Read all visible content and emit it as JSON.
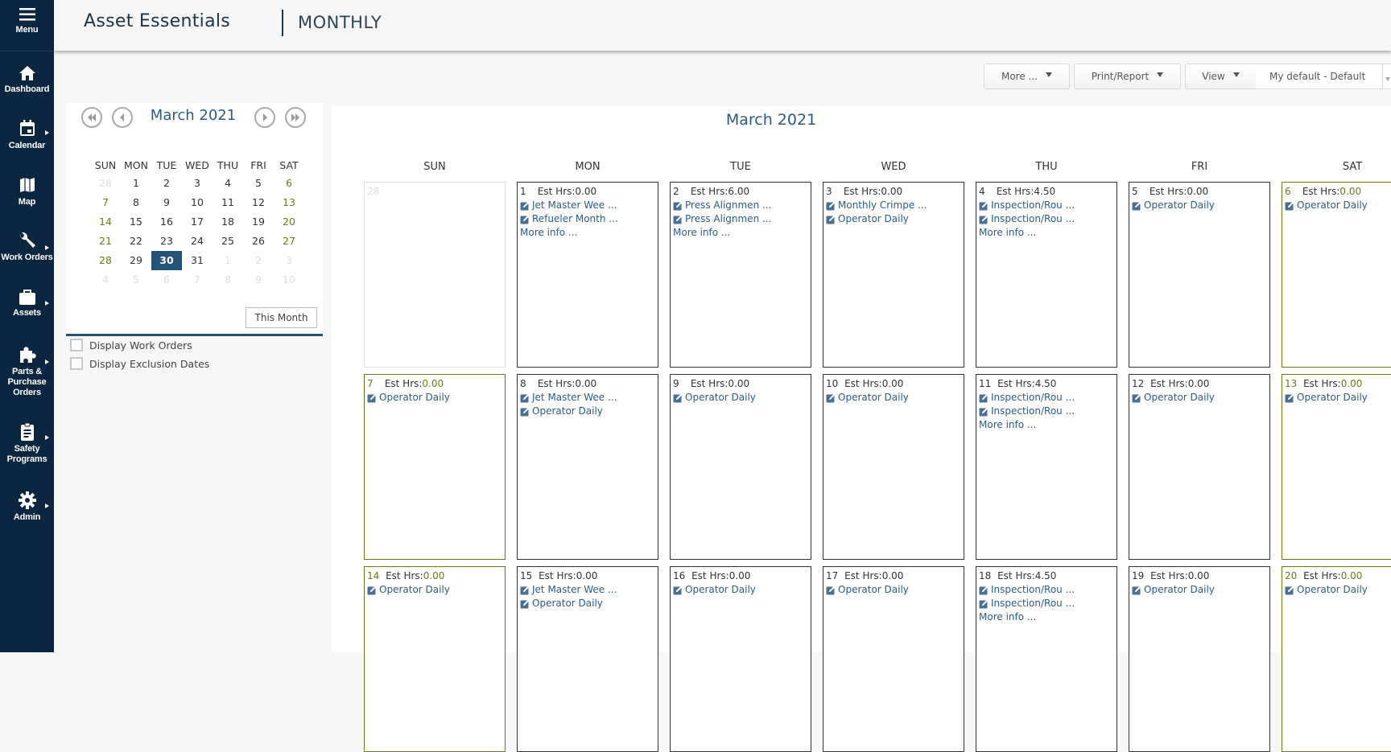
{
  "sidebar": {
    "items": [
      {
        "id": "menu",
        "label": "Menu",
        "icon": "hamburger-icon",
        "has_submenu": false
      },
      {
        "id": "dashboard",
        "label": "Dashboard",
        "icon": "home-icon",
        "has_submenu": false
      },
      {
        "id": "calendar",
        "label": "Calendar",
        "icon": "calendar-icon",
        "has_submenu": true
      },
      {
        "id": "map",
        "label": "Map",
        "icon": "map-icon",
        "has_submenu": false
      },
      {
        "id": "work-orders",
        "label": "Work Orders",
        "icon": "wrench-icon",
        "has_submenu": true
      },
      {
        "id": "assets",
        "label": "Assets",
        "icon": "briefcase-icon",
        "has_submenu": true
      },
      {
        "id": "parts",
        "label": "Parts & Purchase Orders",
        "icon": "puzzle-icon",
        "has_submenu": true
      },
      {
        "id": "safety",
        "label": "Safety Programs",
        "icon": "clipboard-icon",
        "has_submenu": true
      },
      {
        "id": "admin",
        "label": "Admin",
        "icon": "gear-icon",
        "has_submenu": true
      }
    ]
  },
  "header": {
    "app_title": "Asset Essentials",
    "page_title": "MONTHLY"
  },
  "toolbar": {
    "more_label": "More ...",
    "print_label": "Print/Report",
    "view_label": "View",
    "view_default_value": "My default - Default"
  },
  "mini_calendar": {
    "title": "March 2021",
    "weekdays": [
      "SUN",
      "MON",
      "TUE",
      "WED",
      "THU",
      "FRI",
      "SAT"
    ],
    "weeks": [
      [
        {
          "d": "28",
          "t": "other"
        },
        {
          "d": "1"
        },
        {
          "d": "2"
        },
        {
          "d": "3"
        },
        {
          "d": "4"
        },
        {
          "d": "5"
        },
        {
          "d": "6",
          "t": "wk"
        }
      ],
      [
        {
          "d": "7",
          "t": "wk"
        },
        {
          "d": "8"
        },
        {
          "d": "9"
        },
        {
          "d": "10"
        },
        {
          "d": "11"
        },
        {
          "d": "12"
        },
        {
          "d": "13",
          "t": "wk"
        }
      ],
      [
        {
          "d": "14",
          "t": "wk"
        },
        {
          "d": "15"
        },
        {
          "d": "16"
        },
        {
          "d": "17"
        },
        {
          "d": "18"
        },
        {
          "d": "19"
        },
        {
          "d": "20",
          "t": "wk"
        }
      ],
      [
        {
          "d": "21",
          "t": "wk"
        },
        {
          "d": "22"
        },
        {
          "d": "23"
        },
        {
          "d": "24"
        },
        {
          "d": "25"
        },
        {
          "d": "26"
        },
        {
          "d": "27",
          "t": "wk"
        }
      ],
      [
        {
          "d": "28",
          "t": "wk"
        },
        {
          "d": "29"
        },
        {
          "d": "30",
          "t": "sel"
        },
        {
          "d": "31"
        },
        {
          "d": "1",
          "t": "other"
        },
        {
          "d": "2",
          "t": "other"
        },
        {
          "d": "3",
          "t": "other"
        }
      ],
      [
        {
          "d": "4",
          "t": "other"
        },
        {
          "d": "5",
          "t": "other"
        },
        {
          "d": "6",
          "t": "other"
        },
        {
          "d": "7",
          "t": "other"
        },
        {
          "d": "8",
          "t": "other"
        },
        {
          "d": "9",
          "t": "other"
        },
        {
          "d": "10",
          "t": "other"
        }
      ]
    ],
    "this_month_label": "This Month",
    "checkboxes": [
      {
        "label": "Display Work Orders",
        "checked": false
      },
      {
        "label": "Display Exclusion Dates",
        "checked": false
      }
    ]
  },
  "calendar": {
    "title": "March 2021",
    "weekdays": [
      "SUN",
      "MON",
      "TUE",
      "WED",
      "THU",
      "FRI",
      "SAT"
    ],
    "hrs_label": "Est Hrs:",
    "more_info_label": "More info ...",
    "weeks": [
      [
        {
          "day": "28",
          "type": "other",
          "hrs": null,
          "items": [],
          "more": false
        },
        {
          "day": "1",
          "hrs": "0.00",
          "items": [
            "Jet Master Wee ...",
            "Refueler Month ..."
          ],
          "more": true
        },
        {
          "day": "2",
          "hrs": "6.00",
          "items": [
            "Press Alignmen ...",
            "Press Alignmen ..."
          ],
          "more": true
        },
        {
          "day": "3",
          "hrs": "0.00",
          "items": [
            "Monthly Crimpe ...",
            "Operator Daily"
          ],
          "more": false
        },
        {
          "day": "4",
          "hrs": "4.50",
          "items": [
            "Inspection/Rou ...",
            "Inspection/Rou ..."
          ],
          "more": true
        },
        {
          "day": "5",
          "hrs": "0.00",
          "items": [
            "Operator Daily"
          ],
          "more": false
        },
        {
          "day": "6",
          "type": "weekend",
          "hrs": "0.00",
          "items": [
            "Operator Daily"
          ],
          "more": false
        }
      ],
      [
        {
          "day": "7",
          "type": "weekend",
          "hrs": "0.00",
          "items": [
            "Operator Daily"
          ],
          "more": false
        },
        {
          "day": "8",
          "hrs": "0.00",
          "items": [
            "Jet Master Wee ...",
            "Operator Daily"
          ],
          "more": false
        },
        {
          "day": "9",
          "hrs": "0.00",
          "items": [
            "Operator Daily"
          ],
          "more": false
        },
        {
          "day": "10",
          "hrs": "0.00",
          "items": [
            "Operator Daily"
          ],
          "more": false
        },
        {
          "day": "11",
          "hrs": "4.50",
          "items": [
            "Inspection/Rou ...",
            "Inspection/Rou ..."
          ],
          "more": true
        },
        {
          "day": "12",
          "hrs": "0.00",
          "items": [
            "Operator Daily"
          ],
          "more": false
        },
        {
          "day": "13",
          "type": "weekend",
          "hrs": "0.00",
          "items": [
            "Operator Daily"
          ],
          "more": false
        }
      ],
      [
        {
          "day": "14",
          "type": "weekend",
          "hrs": "0.00",
          "items": [
            "Operator Daily"
          ],
          "more": false
        },
        {
          "day": "15",
          "hrs": "0.00",
          "items": [
            "Jet Master Wee ...",
            "Operator Daily"
          ],
          "more": false
        },
        {
          "day": "16",
          "hrs": "0.00",
          "items": [
            "Operator Daily"
          ],
          "more": false
        },
        {
          "day": "17",
          "hrs": "0.00",
          "items": [
            "Operator Daily"
          ],
          "more": false
        },
        {
          "day": "18",
          "hrs": "4.50",
          "items": [
            "Inspection/Rou ...",
            "Inspection/Rou ..."
          ],
          "more": true
        },
        {
          "day": "19",
          "hrs": "0.00",
          "items": [
            "Operator Daily"
          ],
          "more": false
        },
        {
          "day": "20",
          "type": "weekend",
          "hrs": "0.00",
          "items": [
            "Operator Daily"
          ],
          "more": false
        }
      ]
    ]
  },
  "colors": {
    "sidebar_bg": "#0b2640",
    "accent_blue": "#245378",
    "link_blue": "#2e5c84",
    "weekend_olive": "#6a7a1e"
  }
}
